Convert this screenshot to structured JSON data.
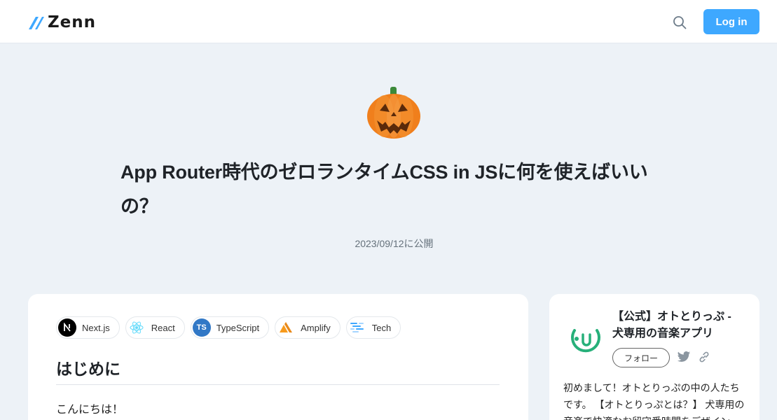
{
  "header": {
    "logo_text": "Zenn",
    "login_label": "Log in"
  },
  "article": {
    "emoji": "jack-o-lantern",
    "title": "App Router時代のゼロランタイムCSS in JSに何を使えばいいの？",
    "published": "2023/09/12に公開"
  },
  "topics": [
    {
      "label": "Next.js",
      "icon": "nextjs-icon"
    },
    {
      "label": "React",
      "icon": "react-icon"
    },
    {
      "label": "TypeScript",
      "icon": "typescript-icon"
    },
    {
      "label": "Amplify",
      "icon": "amplify-icon"
    },
    {
      "label": "Tech",
      "icon": "tech-icon"
    }
  ],
  "content": {
    "heading": "はじめに",
    "first_line": "こんにちは！"
  },
  "author": {
    "name": "【公式】オトとりっぷ - 犬専用の音楽アプリ",
    "follow_label": "フォロー",
    "bio": "初めまして！オトとりっぷの中の人たちです。 【オトとりっぷとは？】 犬専用の音楽で快適なお留守番時間をデザイン"
  },
  "colors": {
    "accent": "#3ea8ff",
    "background": "#edf2f7"
  }
}
